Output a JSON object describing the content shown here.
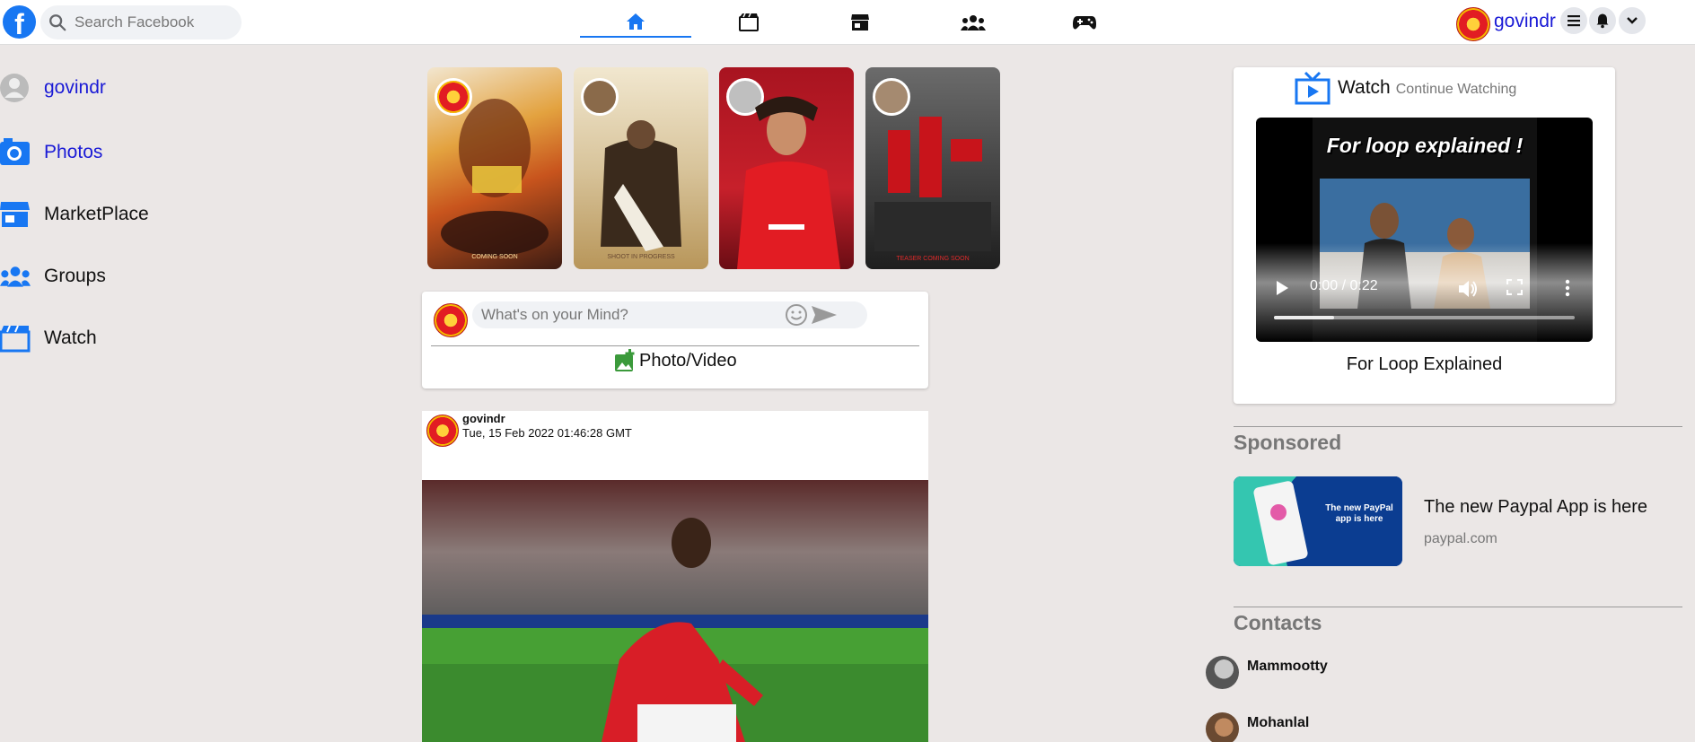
{
  "header": {
    "logo_letter": "f",
    "search_placeholder": "Search Facebook",
    "nav": [
      "home-icon",
      "watch-icon",
      "marketplace-icon",
      "groups-icon",
      "gaming-icon"
    ],
    "username": "govindr",
    "accent": "#1877f2"
  },
  "sidebar": {
    "items": [
      {
        "label": "govindr",
        "icon": "user-icon"
      },
      {
        "label": "Photos",
        "icon": "photos-icon"
      },
      {
        "label": "MarketPlace",
        "icon": "marketplace-icon"
      },
      {
        "label": "Groups",
        "icon": "groups-icon"
      },
      {
        "label": "Watch",
        "icon": "watch-icon"
      }
    ]
  },
  "stories": [
    {
      "name": "story-1",
      "caption": "COMING SOON"
    },
    {
      "name": "story-2",
      "caption": "SHOOT IN PROGRESS"
    },
    {
      "name": "story-3",
      "caption": ""
    },
    {
      "name": "story-4",
      "caption": "TEASER COMING SOON"
    }
  ],
  "composer": {
    "placeholder": "What's on your Mind?",
    "photo_video_label": "Photo/Video"
  },
  "post": {
    "author": "govindr",
    "timestamp": "Tue, 15 Feb 2022 01:46:28 GMT"
  },
  "watch": {
    "title": "Watch",
    "subtitle": "Continue Watching",
    "video_title_overlay": "For loop explained !",
    "time_display": "0:00 / 0:22",
    "progress": 0.2,
    "caption": "For Loop Explained"
  },
  "sponsored": {
    "title": "Sponsored",
    "ad_title": "The new Paypal App is here",
    "ad_url": "paypal.com",
    "ad_image_text": "The new PayPal app is here"
  },
  "contacts": {
    "title": "Contacts",
    "items": [
      "Mammootty",
      "Mohanlal"
    ]
  }
}
